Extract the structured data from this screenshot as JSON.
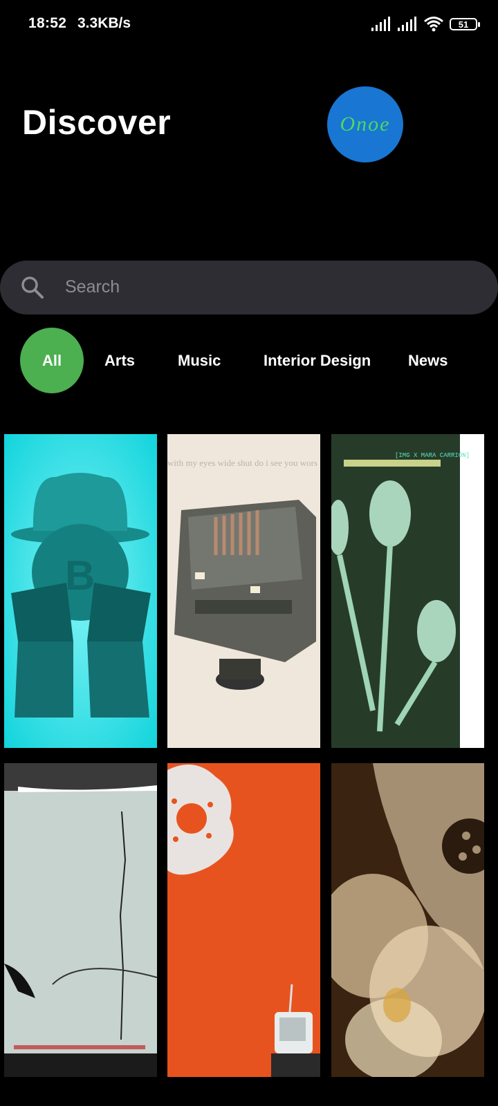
{
  "status": {
    "time": "18:52",
    "speed": "3.3KB/s",
    "battery": "51"
  },
  "header": {
    "title": "Discover",
    "avatar_text": "Onoe",
    "avatar_color": "#1976d2"
  },
  "search": {
    "placeholder": "Search",
    "value": ""
  },
  "categories": [
    {
      "label": "All",
      "active": true
    },
    {
      "label": "Arts",
      "active": false
    },
    {
      "label": "Music",
      "active": false
    },
    {
      "label": "Interior Design",
      "active": false
    },
    {
      "label": "News",
      "active": false
    }
  ],
  "accent": "#4caf50",
  "tiles": [
    {
      "caption_top": ""
    },
    {
      "caption_top": "with my eyes wide shut do i see you wors"
    },
    {
      "caption_top": "[IMG X MARA CARRIÓN]"
    },
    {
      "caption_top": ""
    },
    {
      "caption_top": ""
    },
    {
      "caption_top": ""
    }
  ]
}
